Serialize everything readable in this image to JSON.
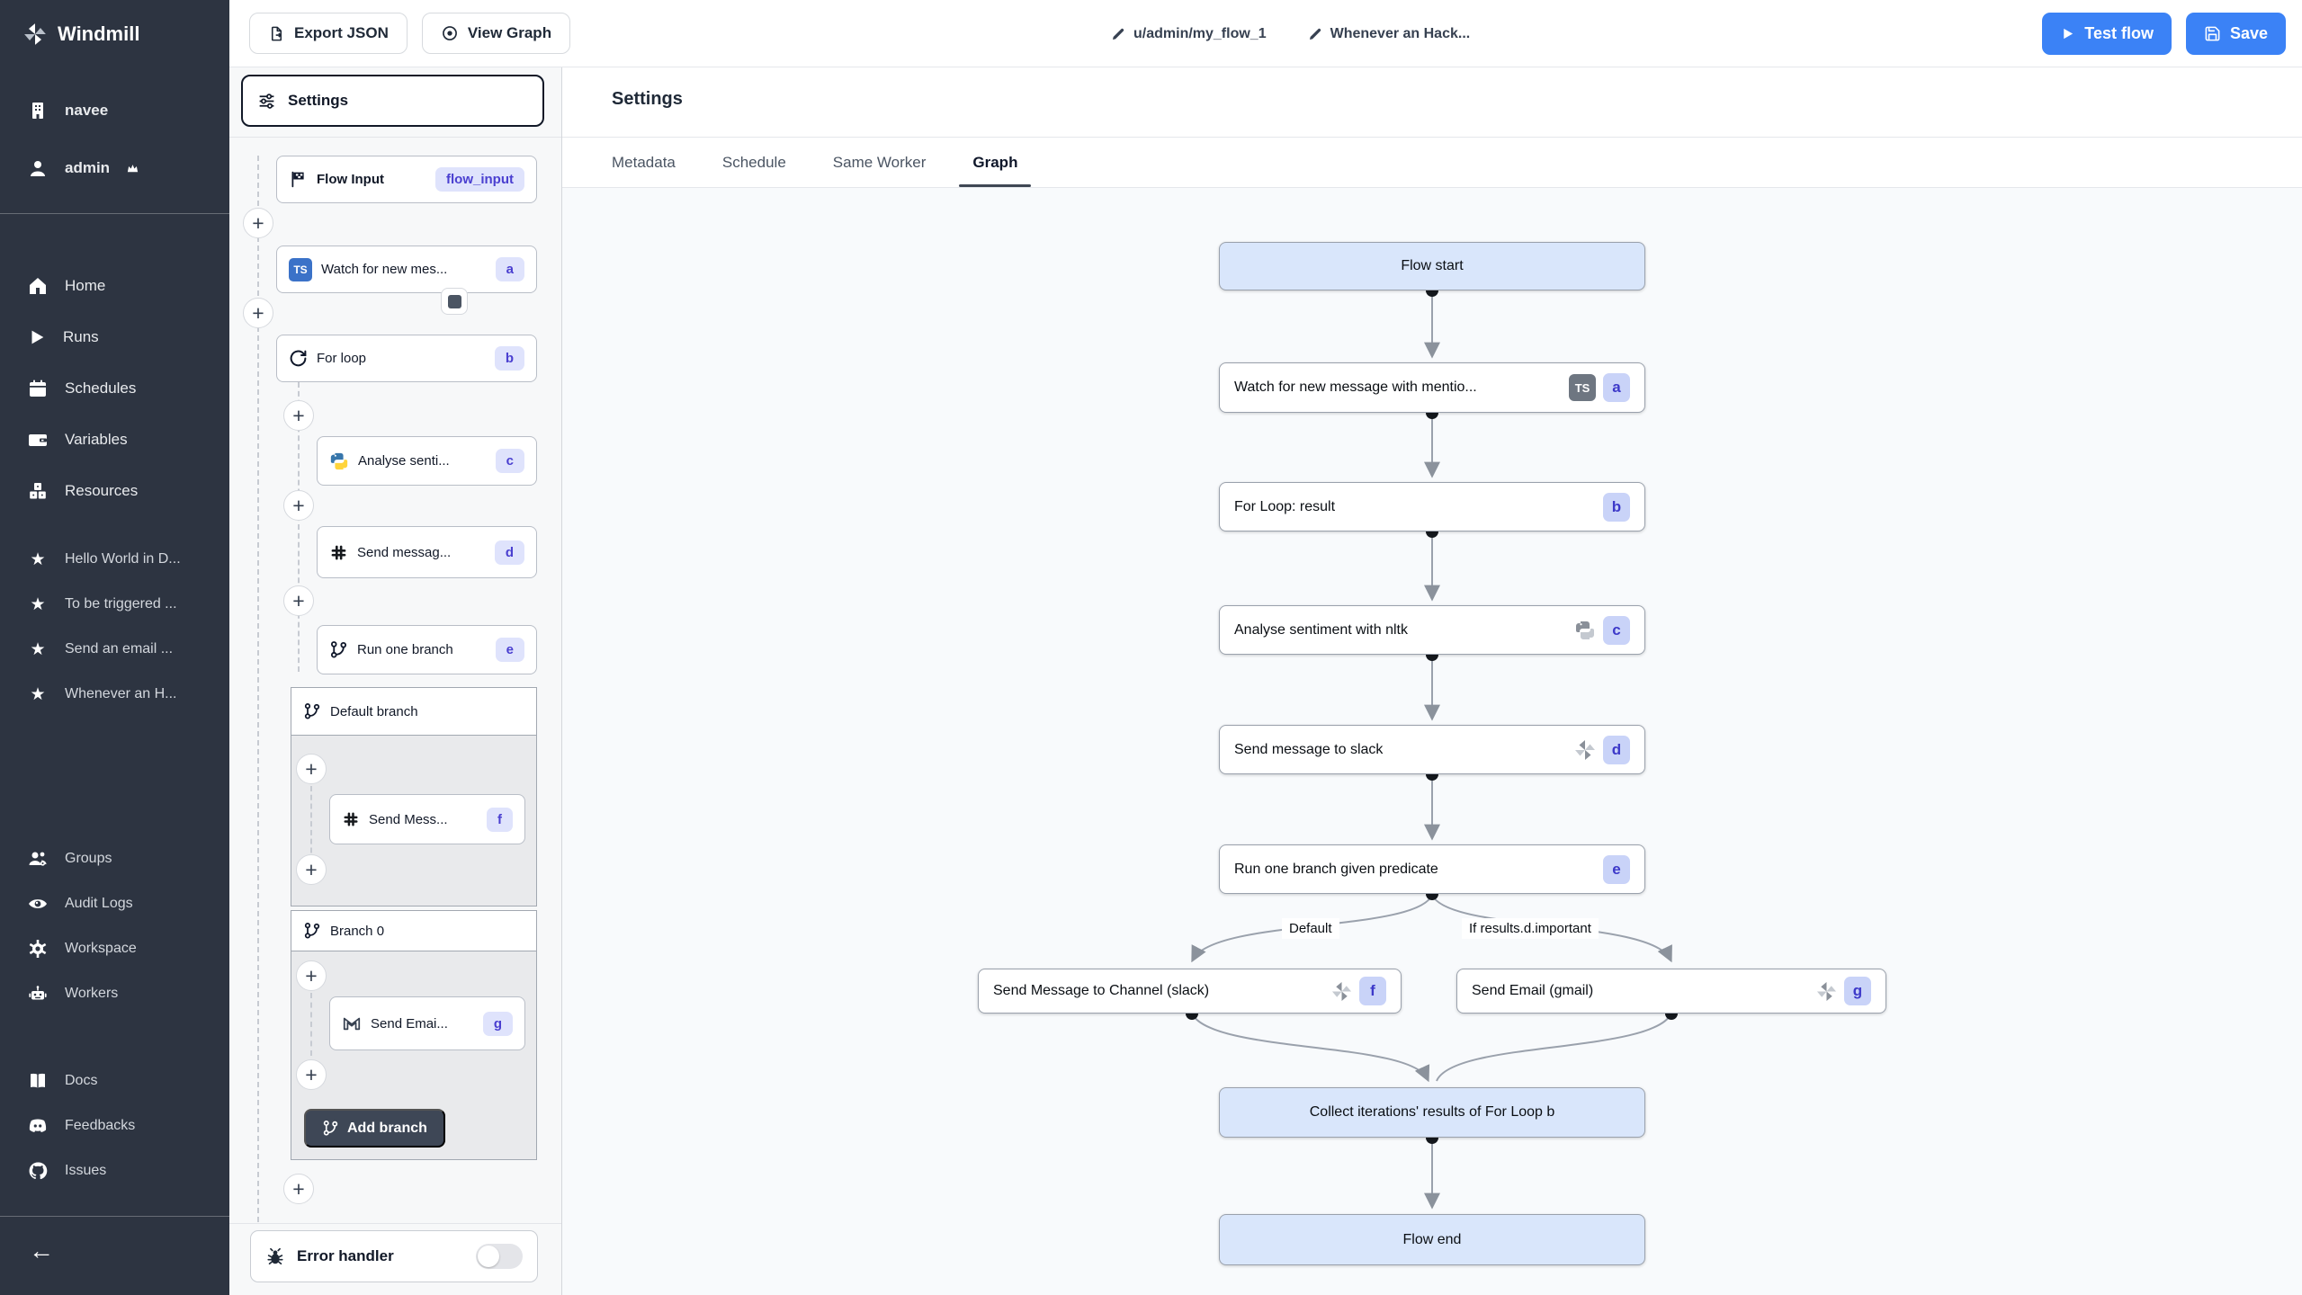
{
  "brand": {
    "name": "Windmill"
  },
  "topbar": {
    "export_json": "Export JSON",
    "view_graph": "View Graph",
    "breadcrumb": {
      "path": "u/admin/my_flow_1",
      "flow_name": "Whenever an Hack..."
    },
    "test_flow": "Test flow",
    "save": "Save"
  },
  "sidebar": {
    "workspace": "navee",
    "user": "admin",
    "nav": [
      {
        "label": "Home"
      },
      {
        "label": "Runs"
      },
      {
        "label": "Schedules"
      },
      {
        "label": "Variables"
      },
      {
        "label": "Resources"
      }
    ],
    "favorites": [
      {
        "label": "Hello World in D..."
      },
      {
        "label": "To be triggered ..."
      },
      {
        "label": "Send an email ..."
      },
      {
        "label": "Whenever an H..."
      }
    ],
    "admin": [
      {
        "label": "Groups"
      },
      {
        "label": "Audit Logs"
      },
      {
        "label": "Workspace"
      },
      {
        "label": "Workers"
      }
    ],
    "links": [
      {
        "label": "Docs"
      },
      {
        "label": "Feedbacks"
      },
      {
        "label": "Issues"
      }
    ]
  },
  "flow_panel": {
    "settings": "Settings",
    "flow_input": {
      "label": "Flow Input",
      "badge": "flow_input"
    },
    "steps": {
      "watch": {
        "label": "Watch for new mes...",
        "badge": "a",
        "lang": "TS"
      },
      "for_loop": {
        "label": "For loop",
        "badge": "b"
      },
      "analyse": {
        "label": "Analyse senti...",
        "badge": "c"
      },
      "send_message": {
        "label": "Send messag...",
        "badge": "d"
      },
      "run_one_branch": {
        "label": "Run one branch",
        "badge": "e"
      },
      "default_branch": {
        "label": "Default branch"
      },
      "send_mess": {
        "label": "Send Mess...",
        "badge": "f"
      },
      "branch_0": {
        "label": "Branch 0"
      },
      "send_email": {
        "label": "Send Emai...",
        "badge": "g"
      }
    },
    "add_branch": "Add branch",
    "error_handler": "Error handler"
  },
  "main": {
    "title": "Settings",
    "tabs": [
      {
        "label": "Metadata"
      },
      {
        "label": "Schedule"
      },
      {
        "label": "Same Worker"
      },
      {
        "label": "Graph",
        "active": true
      }
    ]
  },
  "graph": {
    "nodes": {
      "flow_start": {
        "label": "Flow start"
      },
      "watch": {
        "label": "Watch for new message with mentio...",
        "badge": "a",
        "lang": "TS"
      },
      "for_loop": {
        "label": "For Loop: result",
        "badge": "b"
      },
      "analyse": {
        "label": "Analyse sentiment with nltk",
        "badge": "c"
      },
      "send_slack": {
        "label": "Send message to slack",
        "badge": "d"
      },
      "run_one_branch": {
        "label": "Run one branch given predicate",
        "badge": "e"
      },
      "branch_slack": {
        "label": "Send Message to Channel (slack)",
        "badge": "f"
      },
      "branch_gmail": {
        "label": "Send Email (gmail)",
        "badge": "g"
      },
      "collect": {
        "label": "Collect iterations' results of For Loop b"
      },
      "flow_end": {
        "label": "Flow end"
      }
    },
    "edge_labels": {
      "default": "Default",
      "predicate": "If results.d.important"
    }
  },
  "colors": {
    "accent_blue": "#3b82f6",
    "sidebar_bg": "#2d3441",
    "node_blue": "#d9e6fb",
    "badge_bg": "#dfe3fc",
    "badge_text": "#4a3fd0",
    "graph_bg": "#f8fafc"
  }
}
